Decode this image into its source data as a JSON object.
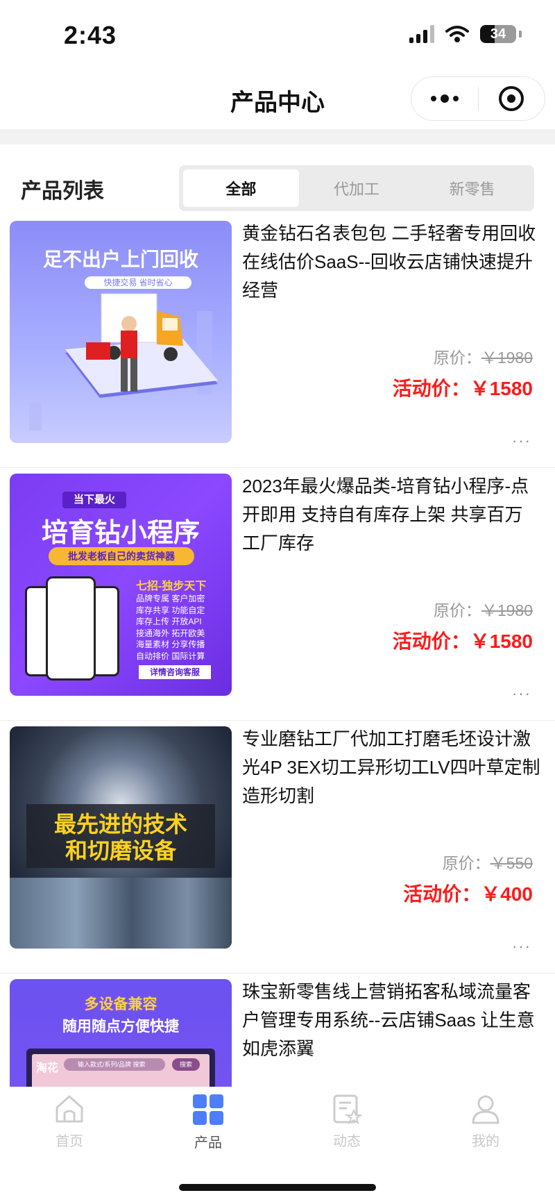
{
  "status_bar": {
    "time": "2:43",
    "battery": "34"
  },
  "header": {
    "title": "产品中心"
  },
  "section": {
    "title": "产品列表"
  },
  "tabs_filter": [
    {
      "label": "全部",
      "active": true
    },
    {
      "label": "代加工",
      "active": false
    },
    {
      "label": "新零售",
      "active": false
    }
  ],
  "products": [
    {
      "title": "黄金钻石名表包包 二手轻奢专用回收在线估价SaaS--回收云店铺快速提升经营",
      "orig_label": "原价：",
      "orig_price": "￥1980",
      "sale_label": "活动价：",
      "sale_price": "￥1580",
      "image_text": {
        "headline": "足不出户上门回收",
        "sub": "快捷交易 省时省心"
      }
    },
    {
      "title": "2023年最火爆品类-培育钻小程序-点开即用 支持自有库存上架 共享百万工厂库存",
      "orig_label": "原价：",
      "orig_price": "￥1980",
      "sale_label": "活动价：",
      "sale_price": "￥1580",
      "image_text": {
        "tag": "当下最火",
        "headline": "培育钻小程序",
        "sub": "批发老板自己的卖货神器",
        "list_title": "七招-独步天下",
        "items": [
          "品牌专属 客户加密",
          "库存共享 功能自定",
          "库存上传 开放API",
          "接通海外 拓开欧美",
          "海量素材 分享传播",
          "自动排价 国际计算"
        ],
        "cta": "详情咨询客服"
      }
    },
    {
      "title": "专业磨钻工厂代加工打磨毛坯设计激光4P 3EX切工异形切工LV四叶草定制造形切割",
      "orig_label": "原价：",
      "orig_price": "￥550",
      "sale_label": "活动价：",
      "sale_price": "￥400",
      "image_text": {
        "line1": "最先进的技术",
        "line2": "和切磨设备"
      }
    },
    {
      "title": "珠宝新零售线上营销拓客私域流量客户管理专用系统--云店铺Saas 让生意如虎添翼",
      "image_text": {
        "line1": "多设备兼容",
        "line2": "随用随点方便快捷",
        "brand": "淘花",
        "search_placeholder": "输入款式/系列/品牌 搜索",
        "search_btn": "搜索"
      }
    }
  ],
  "more_symbol": "···",
  "tabbar": [
    {
      "label": "首页",
      "icon": "home-icon",
      "active": false
    },
    {
      "label": "产品",
      "icon": "grid-icon",
      "active": true
    },
    {
      "label": "动态",
      "icon": "news-icon",
      "active": false
    },
    {
      "label": "我的",
      "icon": "user-icon",
      "active": false
    }
  ],
  "colors": {
    "accent_blue": "#4e7ef7",
    "price_red": "#ff1a1a"
  }
}
